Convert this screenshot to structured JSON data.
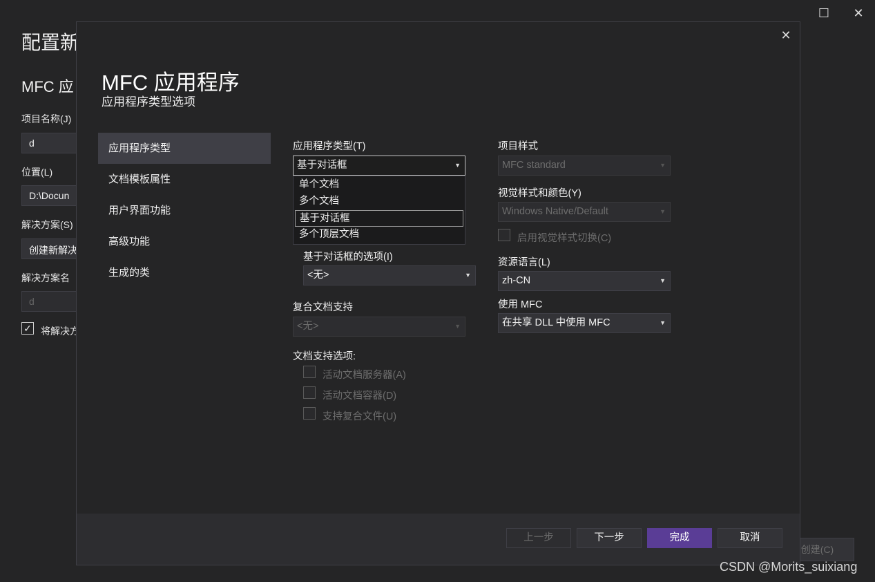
{
  "background_window": {
    "title": "配置新",
    "subtitle": "MFC 应",
    "project_name_label": "项目名称(J)",
    "project_name_value": "d",
    "location_label": "位置(L)",
    "location_value": "D:\\Docun",
    "solution_label": "解决方案(S)",
    "solution_value": "创建新解决",
    "solution_name_label": "解决方案名",
    "solution_name_value": "d",
    "same_dir_label": "将解决方",
    "same_dir_checked": "✓",
    "create_button": "创建(C)",
    "maximize_icon": "☐",
    "close_icon": "✕"
  },
  "dialog": {
    "title": "MFC 应用程序",
    "subtitle": "应用程序类型选项",
    "close_icon": "✕",
    "nav": [
      {
        "label": "应用程序类型",
        "selected": true
      },
      {
        "label": "文档模板属性"
      },
      {
        "label": "用户界面功能"
      },
      {
        "label": "高级功能"
      },
      {
        "label": "生成的类"
      }
    ],
    "app_type": {
      "label": "应用程序类型(T)",
      "value": "基于对话框",
      "options": [
        "单个文档",
        "多个文档",
        "基于对话框",
        "多个顶层文档"
      ],
      "highlighted": "基于对话框"
    },
    "dialog_options": {
      "label": "基于对话框的选项(I)",
      "value": "<无>"
    },
    "compound_doc": {
      "label": "复合文档支持",
      "value": "<无>"
    },
    "doc_support": {
      "label": "文档支持选项:",
      "items": [
        "活动文档服务器(A)",
        "活动文档容器(D)",
        "支持复合文件(U)"
      ]
    },
    "project_style": {
      "label": "项目样式",
      "value": "MFC standard"
    },
    "visual_style": {
      "label": "视觉样式和颜色(Y)",
      "value": "Windows Native/Default",
      "switch_label": "启用视觉样式切换(C)"
    },
    "resource_lang": {
      "label": "资源语言(L)",
      "value": "zh-CN"
    },
    "use_mfc": {
      "label": "使用 MFC",
      "value": "在共享 DLL 中使用 MFC"
    },
    "buttons": {
      "prev": "上一步",
      "next": "下一步",
      "finish": "完成",
      "cancel": "取消"
    },
    "caret": "▼"
  },
  "watermark": "CSDN @Morits_suixiang",
  "colors": {
    "background": "#252526",
    "accent": "#5a3d96",
    "selected": "#3f3f46"
  }
}
